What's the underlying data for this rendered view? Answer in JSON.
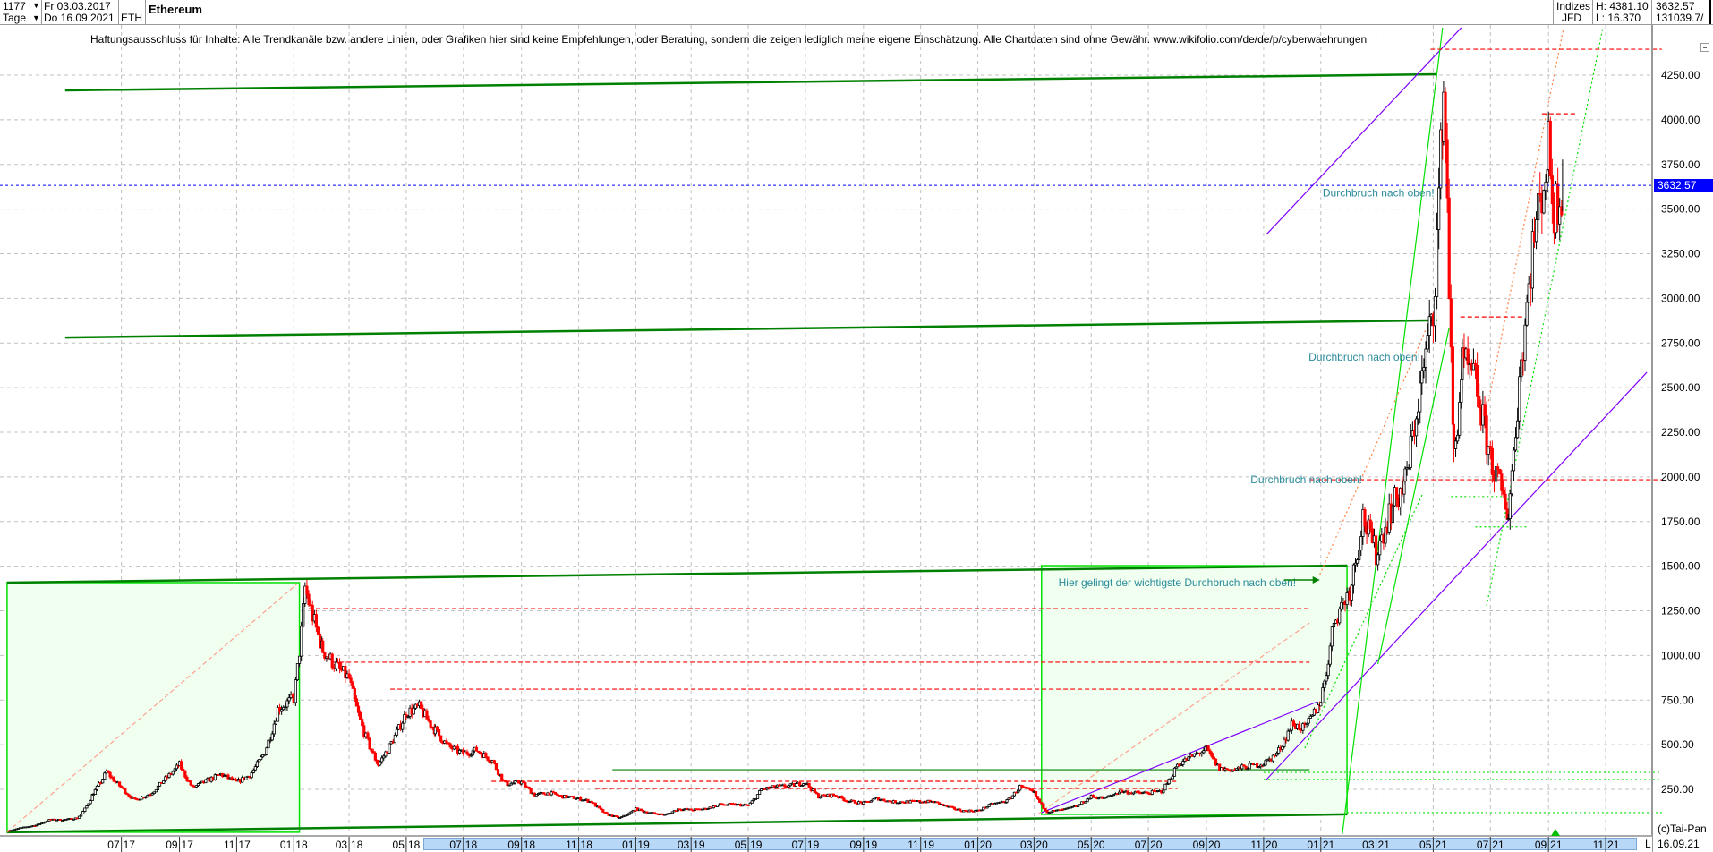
{
  "header": {
    "count": "1177",
    "period": "Tage",
    "start_date": "Fr 03.03.2017",
    "end_date": "Do 16.09.2021",
    "symbol": "ETH",
    "name": "Ethereum",
    "exchange_top": "Indizes",
    "exchange_bottom": "JFD",
    "high": "H: 4381.10",
    "low": "L: 16.370",
    "last": "3632.57",
    "volume": "131039.7/"
  },
  "disclaimer": "Haftungsausschluss für Inhalte: Alle Trendkanäle bzw. andere Linien, oder Grafiken hier sind keine Empfehlungen, oder Beratung, sondern die zeigen lediglich meine eigene Einschätzung. Alle Chartdaten sind ohne Gewähr.  www.wikifolio.com/de/de/p/cyberwaehrungen",
  "footer": {
    "copyright": "(c)Tai-Pan",
    "scale_mode": "L",
    "date": "16.09.21"
  },
  "icons": {
    "dropdown": "triangle-down-icon",
    "collapse": "minus-icon",
    "marker": "triangle-up-icon"
  },
  "colors": {
    "up_candle": "#000000",
    "down_candle": "#ff0000",
    "last_price": "#0000ff",
    "grid": "#c0c0c0",
    "axis_band": "#b8d8f8"
  },
  "chart_data": {
    "type": "candlestick",
    "title": "Ethereum",
    "ylim": [
      0,
      4535
    ],
    "last_price": 3632.57,
    "last_price_label": "3632.57",
    "grid": true,
    "y_ticks": [
      "250.00",
      "500.00",
      "750.00",
      "1000.00",
      "1250.00",
      "1500.00",
      "1750.00",
      "2000.00",
      "2250.00",
      "2500.00",
      "2750.00",
      "3000.00",
      "3250.00",
      "3500.00",
      "3750.00",
      "4000.00",
      "4250.00"
    ],
    "x_ticks": [
      {
        "date": "2017-07-01",
        "label": [
          "07",
          "17"
        ]
      },
      {
        "date": "2017-09-01",
        "label": [
          "09",
          "17"
        ]
      },
      {
        "date": "2017-11-01",
        "label": [
          "11",
          "17"
        ]
      },
      {
        "date": "2018-01-01",
        "label": [
          "01",
          "18"
        ]
      },
      {
        "date": "2018-03-01",
        "label": [
          "03",
          "18"
        ]
      },
      {
        "date": "2018-05-01",
        "label": [
          "05",
          "18"
        ]
      },
      {
        "date": "2018-07-01",
        "label": [
          "07",
          "18"
        ]
      },
      {
        "date": "2018-09-01",
        "label": [
          "09",
          "18"
        ]
      },
      {
        "date": "2018-11-01",
        "label": [
          "11",
          "18"
        ]
      },
      {
        "date": "2019-01-01",
        "label": [
          "01",
          "19"
        ]
      },
      {
        "date": "2019-03-01",
        "label": [
          "03",
          "19"
        ]
      },
      {
        "date": "2019-05-01",
        "label": [
          "05",
          "19"
        ]
      },
      {
        "date": "2019-07-01",
        "label": [
          "07",
          "19"
        ]
      },
      {
        "date": "2019-09-01",
        "label": [
          "09",
          "19"
        ]
      },
      {
        "date": "2019-11-01",
        "label": [
          "11",
          "19"
        ]
      },
      {
        "date": "2020-01-01",
        "label": [
          "01",
          "20"
        ]
      },
      {
        "date": "2020-03-01",
        "label": [
          "03",
          "20"
        ]
      },
      {
        "date": "2020-05-01",
        "label": [
          "05",
          "20"
        ]
      },
      {
        "date": "2020-07-01",
        "label": [
          "07",
          "20"
        ]
      },
      {
        "date": "2020-09-01",
        "label": [
          "09",
          "20"
        ]
      },
      {
        "date": "2020-11-01",
        "label": [
          "11",
          "20"
        ]
      },
      {
        "date": "2021-01-01",
        "label": [
          "01",
          "21"
        ]
      },
      {
        "date": "2021-03-01",
        "label": [
          "03",
          "21"
        ]
      },
      {
        "date": "2021-05-01",
        "label": [
          "05",
          "21"
        ]
      },
      {
        "date": "2021-07-01",
        "label": [
          "07",
          "21"
        ]
      },
      {
        "date": "2021-09-01",
        "label": [
          "09",
          "21"
        ]
      },
      {
        "date": "2021-11-01",
        "label": [
          "11",
          "21"
        ]
      }
    ],
    "closes": [
      [
        "2017-03-03",
        19
      ],
      [
        "2017-03-15",
        35
      ],
      [
        "2017-04-01",
        50
      ],
      [
        "2017-04-15",
        80
      ],
      [
        "2017-05-01",
        80
      ],
      [
        "2017-05-15",
        90
      ],
      [
        "2017-06-01",
        230
      ],
      [
        "2017-06-15",
        350
      ],
      [
        "2017-07-01",
        260
      ],
      [
        "2017-07-15",
        190
      ],
      [
        "2017-08-01",
        225
      ],
      [
        "2017-08-15",
        300
      ],
      [
        "2017-09-01",
        390
      ],
      [
        "2017-09-15",
        260
      ],
      [
        "2017-10-01",
        300
      ],
      [
        "2017-10-15",
        335
      ],
      [
        "2017-11-01",
        290
      ],
      [
        "2017-11-15",
        330
      ],
      [
        "2017-12-01",
        460
      ],
      [
        "2017-12-15",
        700
      ],
      [
        "2018-01-01",
        760
      ],
      [
        "2018-01-13",
        1380
      ],
      [
        "2018-02-01",
        1030
      ],
      [
        "2018-02-15",
        940
      ],
      [
        "2018-03-01",
        870
      ],
      [
        "2018-03-15",
        600
      ],
      [
        "2018-04-01",
        390
      ],
      [
        "2018-04-15",
        510
      ],
      [
        "2018-05-01",
        680
      ],
      [
        "2018-05-15",
        710
      ],
      [
        "2018-06-01",
        580
      ],
      [
        "2018-06-15",
        490
      ],
      [
        "2018-07-01",
        450
      ],
      [
        "2018-07-15",
        470
      ],
      [
        "2018-08-01",
        410
      ],
      [
        "2018-08-15",
        280
      ],
      [
        "2018-09-01",
        290
      ],
      [
        "2018-09-15",
        220
      ],
      [
        "2018-10-01",
        230
      ],
      [
        "2018-10-15",
        210
      ],
      [
        "2018-11-01",
        200
      ],
      [
        "2018-11-15",
        180
      ],
      [
        "2018-12-01",
        110
      ],
      [
        "2018-12-15",
        90
      ],
      [
        "2019-01-01",
        140
      ],
      [
        "2019-01-15",
        120
      ],
      [
        "2019-02-01",
        107
      ],
      [
        "2019-02-15",
        140
      ],
      [
        "2019-03-01",
        135
      ],
      [
        "2019-03-15",
        140
      ],
      [
        "2019-04-01",
        165
      ],
      [
        "2019-04-15",
        165
      ],
      [
        "2019-05-01",
        160
      ],
      [
        "2019-05-15",
        250
      ],
      [
        "2019-06-01",
        265
      ],
      [
        "2019-06-15",
        270
      ],
      [
        "2019-07-01",
        290
      ],
      [
        "2019-07-15",
        210
      ],
      [
        "2019-08-01",
        220
      ],
      [
        "2019-08-15",
        185
      ],
      [
        "2019-09-01",
        172
      ],
      [
        "2019-09-15",
        200
      ],
      [
        "2019-10-01",
        180
      ],
      [
        "2019-10-15",
        180
      ],
      [
        "2019-11-01",
        182
      ],
      [
        "2019-11-15",
        180
      ],
      [
        "2019-12-01",
        150
      ],
      [
        "2019-12-15",
        130
      ],
      [
        "2020-01-01",
        130
      ],
      [
        "2020-01-15",
        165
      ],
      [
        "2020-02-01",
        185
      ],
      [
        "2020-02-15",
        265
      ],
      [
        "2020-03-01",
        230
      ],
      [
        "2020-03-15",
        125
      ],
      [
        "2020-04-01",
        135
      ],
      [
        "2020-04-15",
        155
      ],
      [
        "2020-05-01",
        210
      ],
      [
        "2020-05-15",
        200
      ],
      [
        "2020-06-01",
        240
      ],
      [
        "2020-06-15",
        230
      ],
      [
        "2020-07-01",
        230
      ],
      [
        "2020-07-15",
        240
      ],
      [
        "2020-08-01",
        390
      ],
      [
        "2020-08-15",
        430
      ],
      [
        "2020-09-01",
        475
      ],
      [
        "2020-09-15",
        365
      ],
      [
        "2020-10-01",
        360
      ],
      [
        "2020-10-15",
        380
      ],
      [
        "2020-11-01",
        395
      ],
      [
        "2020-11-15",
        450
      ],
      [
        "2020-12-01",
        615
      ],
      [
        "2020-12-15",
        590
      ],
      [
        "2021-01-01",
        750
      ],
      [
        "2021-01-15",
        1200
      ],
      [
        "2021-02-01",
        1370
      ],
      [
        "2021-02-15",
        1780
      ],
      [
        "2021-03-01",
        1570
      ],
      [
        "2021-03-15",
        1800
      ],
      [
        "2021-04-01",
        1970
      ],
      [
        "2021-04-15",
        2430
      ],
      [
        "2021-05-01",
        2950
      ],
      [
        "2021-05-12",
        4170
      ],
      [
        "2021-05-16",
        3600
      ],
      [
        "2021-05-23",
        2100
      ],
      [
        "2021-06-01",
        2630
      ],
      [
        "2021-06-15",
        2530
      ],
      [
        "2021-07-01",
        2110
      ],
      [
        "2021-07-20",
        1800
      ],
      [
        "2021-08-01",
        2560
      ],
      [
        "2021-08-15",
        3300
      ],
      [
        "2021-09-01",
        3830
      ],
      [
        "2021-09-07",
        3500
      ],
      [
        "2021-09-16",
        3632.57
      ]
    ],
    "boxes": [
      {
        "from": [
          "2017-03-01",
          10
        ],
        "to": [
          "2018-01-07",
          1408
        ]
      },
      {
        "from": [
          "2020-03-09",
          110
        ],
        "to": [
          "2021-01-29",
          1503
        ]
      }
    ],
    "lines": [
      {
        "from": [
          "2017-05-02",
          4165
        ],
        "to": [
          "2021-05-05",
          4255
        ],
        "color": "#008000",
        "style": "thick"
      },
      {
        "from": [
          "2017-05-02",
          2781
        ],
        "to": [
          "2021-05-05",
          2877
        ],
        "color": "#008000",
        "style": "thick"
      },
      {
        "from": [
          "2017-03-01",
          1408
        ],
        "to": [
          "2021-01-29",
          1503
        ],
        "color": "#008000",
        "style": "thick"
      },
      {
        "from": [
          "2017-03-01",
          10
        ],
        "to": [
          "2021-01-29",
          110
        ],
        "color": "#008000",
        "style": "thick"
      },
      {
        "from": [
          "2018-12-07",
          360
        ],
        "to": [
          "2020-12-20",
          360
        ],
        "color": "#008000",
        "style": "solid"
      },
      {
        "from": [
          "2020-11-04",
          3358
        ],
        "to": [
          "2021-05-31",
          4516
        ],
        "color": "#8000ff",
        "style": "solid"
      },
      {
        "from": [
          "2020-11-04",
          305
        ],
        "to": [
          "2021-12-15",
          2586
        ],
        "color": "#8000ff",
        "style": "solid"
      },
      {
        "from": [
          "2020-03-09",
          120
        ],
        "to": [
          "2020-12-28",
          740
        ],
        "color": "#8000ff",
        "style": "solid"
      },
      {
        "from": [
          "2021-01-24",
          0
        ],
        "to": [
          "2021-05-11",
          4516
        ],
        "color": "#00e000",
        "style": "solid"
      },
      {
        "from": [
          "2021-03-03",
          952
        ],
        "to": [
          "2021-05-18",
          2836
        ],
        "color": "#00e000",
        "style": "solid"
      },
      {
        "from": [
          "2021-06-27",
          1278
        ],
        "to": [
          "2021-10-29",
          4516
        ],
        "color": "#00e000",
        "style": "dotted"
      },
      {
        "from": [
          "2020-12-15",
          480
        ],
        "to": [
          "2021-04-20",
          1909
        ],
        "color": "#00e000",
        "style": "dotted"
      },
      {
        "from": [
          "2021-06-29",
          2425
        ],
        "to": [
          "2021-09-17",
          4510
        ],
        "color": "#ff8040",
        "style": "dotted"
      },
      {
        "from": [
          "2020-12-31",
          1453
        ],
        "to": [
          "2021-04-24",
          2836
        ],
        "color": "#ff8040",
        "style": "dotted"
      },
      {
        "from": [
          "2017-03-01",
          10
        ],
        "to": [
          "2018-01-04",
          1398
        ],
        "color": "#ffa090",
        "style": "dashed"
      },
      {
        "from": [
          "2020-03-05",
          110
        ],
        "to": [
          "2020-12-20",
          1182
        ],
        "color": "#ffa090",
        "style": "dashed"
      },
      {
        "from": [
          "2021-04-28",
          4395
        ],
        "to": [
          "2021-12-31",
          4395
        ],
        "color": "#ff0000",
        "style": "dashed"
      },
      {
        "from": [
          "2021-08-25",
          4034
        ],
        "to": [
          "2021-09-30",
          4034
        ],
        "color": "#ff0000",
        "style": "dashed"
      },
      {
        "from": [
          "2021-05-30",
          2896
        ],
        "to": [
          "2021-08-04",
          2896
        ],
        "color": "#ff0000",
        "style": "dashed"
      },
      {
        "from": [
          "2020-12-20",
          1984
        ],
        "to": [
          "2021-12-31",
          1984
        ],
        "color": "#ff0000",
        "style": "dashed"
      },
      {
        "from": [
          "2018-01-17",
          1262
        ],
        "to": [
          "2020-12-20",
          1262
        ],
        "color": "#ff0000",
        "style": "dashed"
      },
      {
        "from": [
          "2018-02-11",
          962
        ],
        "to": [
          "2020-12-20",
          962
        ],
        "color": "#ff0000",
        "style": "dashed"
      },
      {
        "from": [
          "2018-04-14",
          811
        ],
        "to": [
          "2020-12-20",
          811
        ],
        "color": "#ff0000",
        "style": "dashed"
      },
      {
        "from": [
          "2018-07-31",
          295
        ],
        "to": [
          "2020-08-01",
          295
        ],
        "color": "#ff0000",
        "style": "dashed"
      },
      {
        "from": [
          "2018-11-19",
          255
        ],
        "to": [
          "2020-08-01",
          255
        ],
        "color": "#ff0000",
        "style": "dashed"
      },
      {
        "from": [
          "2020-11-01",
          345
        ],
        "to": [
          "2021-12-31",
          345
        ],
        "color": "#00e000",
        "style": "dotted"
      },
      {
        "from": [
          "2020-11-01",
          305
        ],
        "to": [
          "2021-12-31",
          305
        ],
        "color": "#00e000",
        "style": "dotted"
      },
      {
        "from": [
          "2021-01-29",
          120
        ],
        "to": [
          "2021-12-31",
          120
        ],
        "color": "#00e000",
        "style": "dotted"
      },
      {
        "from": [
          "2021-06-15",
          1720
        ],
        "to": [
          "2021-08-10",
          1720
        ],
        "color": "#00e000",
        "style": "dotted"
      },
      {
        "from": [
          "2021-05-20",
          1890
        ],
        "to": [
          "2021-07-15",
          1890
        ],
        "color": "#00e000",
        "style": "dotted"
      }
    ],
    "annotations": [
      {
        "text": "Durchbruch nach oben!",
        "at": [
          "2021-01-03",
          3570
        ]
      },
      {
        "text": "Durchbruch nach oben!",
        "at": [
          "2020-12-19",
          2651
        ]
      },
      {
        "text": "Durchbruch nach oben!",
        "at": [
          "2020-10-18",
          1964
        ]
      },
      {
        "text": "Hier gelingt der wichtigste Durchbruch nach oben!",
        "at": [
          "2020-03-27",
          1388
        ],
        "arrow_to": [
          "2020-12-31",
          1423
        ]
      }
    ]
  }
}
